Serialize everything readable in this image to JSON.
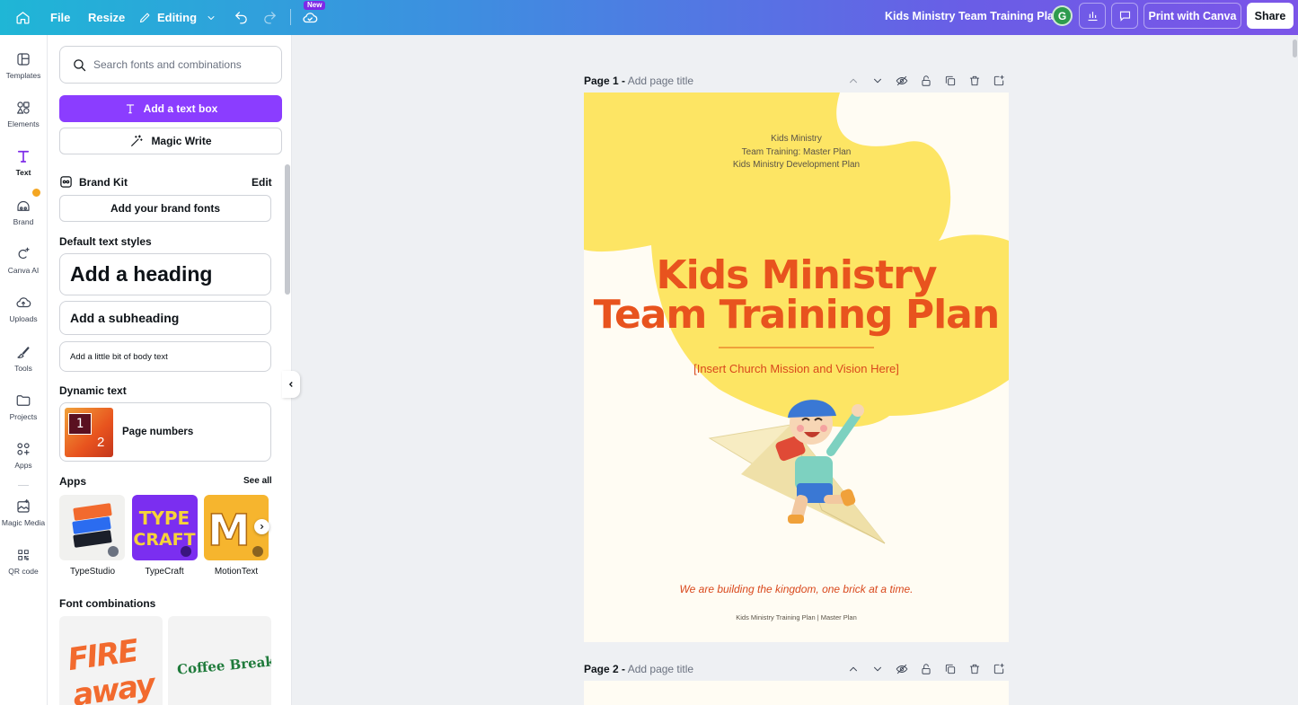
{
  "topbar": {
    "file": "File",
    "resize": "Resize",
    "mode": "Editing",
    "new_badge": "New",
    "doc_title": "Kids Ministry Team Training Plan",
    "avatar_initial": "G",
    "print": "Print with Canva",
    "share": "Share"
  },
  "rail": {
    "items": [
      {
        "label": "Templates",
        "icon": "templates-icon"
      },
      {
        "label": "Elements",
        "icon": "elements-icon"
      },
      {
        "label": "Text",
        "icon": "text-icon"
      },
      {
        "label": "Brand",
        "icon": "brand-icon"
      },
      {
        "label": "Canva AI",
        "icon": "canva-ai-icon"
      },
      {
        "label": "Uploads",
        "icon": "uploads-icon"
      },
      {
        "label": "Tools",
        "icon": "tools-icon"
      },
      {
        "label": "Projects",
        "icon": "projects-icon"
      },
      {
        "label": "Apps",
        "icon": "apps-icon"
      },
      {
        "label": "Magic Media",
        "icon": "magic-media-icon"
      },
      {
        "label": "QR code",
        "icon": "qr-code-icon"
      }
    ]
  },
  "panel": {
    "search_placeholder": "Search fonts and combinations",
    "add_text_box": "Add a text box",
    "magic_write": "Magic Write",
    "brand_kit": "Brand Kit",
    "brand_edit": "Edit",
    "add_brand_fonts": "Add your brand fonts",
    "default_styles": "Default text styles",
    "heading": "Add a heading",
    "subheading": "Add a subheading",
    "body": "Add a little bit of body text",
    "dynamic_text": "Dynamic text",
    "page_numbers": "Page numbers",
    "page_numbers_thumb": [
      "1",
      "2"
    ],
    "apps_title": "Apps",
    "see_all": "See all",
    "apps": [
      {
        "name": "TypeStudio"
      },
      {
        "name": "TypeCraft"
      },
      {
        "name": "MotionText"
      }
    ],
    "font_combinations": "Font combinations",
    "combos": [
      "FIRE away",
      "Coffee Break"
    ]
  },
  "canvas": {
    "page1_label": "Page 1 -",
    "page1_title_placeholder": "Add page title",
    "page2_label": "Page 2 -",
    "page2_title_placeholder": "Add page title",
    "page": {
      "top_lines": [
        "Kids Ministry",
        "Team Training: Master Plan",
        "Kids Ministry Development Plan"
      ],
      "heading_line1": "Kids Ministry",
      "heading_line2": "Team Training Plan",
      "mission": "[Insert Church Mission and Vision Here]",
      "quote": "We are building the kingdom, one brick at a time.",
      "footer": "Kids Ministry Training Plan   | Master Plan"
    },
    "colors": {
      "page_bg": "#fffcf3",
      "blob": "#fde564",
      "heading": "#e8531e",
      "accent": "#8b3dff"
    }
  }
}
